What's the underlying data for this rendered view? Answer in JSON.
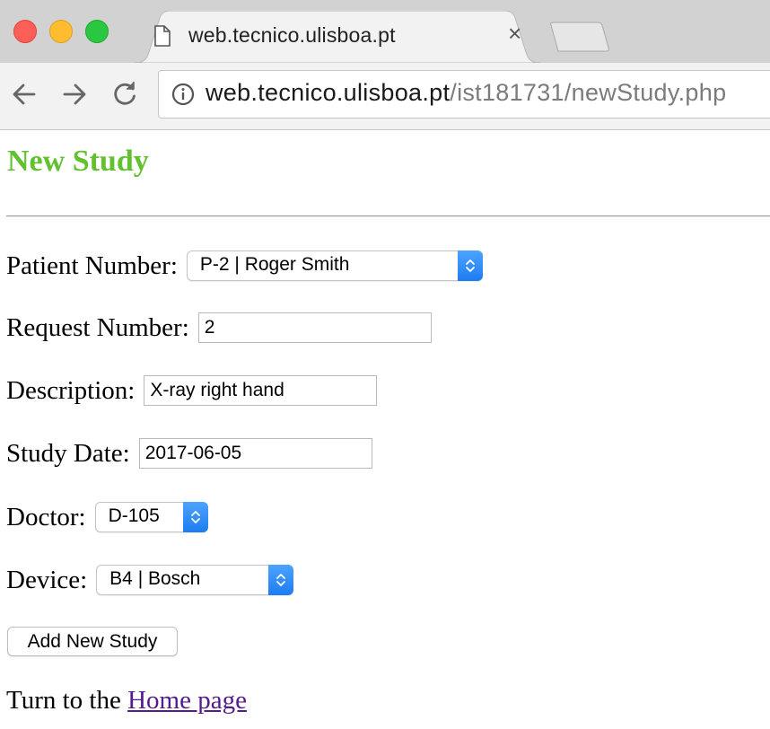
{
  "browser": {
    "tab_title": "web.tecnico.ulisboa.pt",
    "url_host": "web.tecnico.ulisboa.pt",
    "url_path": "/ist181731/newStudy.php"
  },
  "page": {
    "title": "New Study",
    "title_color": "#62c12f",
    "link_color": "#551a8b"
  },
  "form": {
    "patient": {
      "label": "Patient Number:",
      "selected": "P-2 | Roger Smith"
    },
    "request": {
      "label": "Request Number:",
      "value": "2"
    },
    "description": {
      "label": "Description:",
      "value": "X-ray right hand"
    },
    "date": {
      "label": "Study Date:",
      "value": "2017-06-05"
    },
    "doctor": {
      "label": "Doctor:",
      "selected": "D-105"
    },
    "device": {
      "label": "Device:",
      "selected": "B4 | Bosch"
    },
    "submit_label": "Add New Study"
  },
  "footer": {
    "prefix": "Turn to the ",
    "link_text": "Home page"
  }
}
